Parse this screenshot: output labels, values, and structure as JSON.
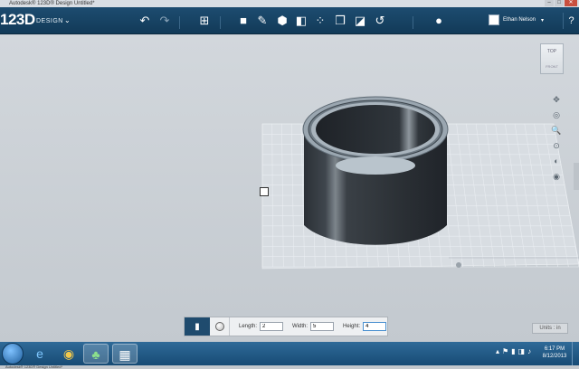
{
  "window": {
    "title": "Autodesk® 123D® Design Untitled*",
    "controls": {
      "minimize": "–",
      "maximize": "□",
      "close": "✕"
    }
  },
  "app": {
    "logo_main": "123D",
    "logo_sub": "DESIGN",
    "menu_caret": "⌄",
    "user_name": "Ethan Nelson",
    "user_caret": "▾",
    "help": "?"
  },
  "toolbar": {
    "undo": "↶",
    "redo": "↷",
    "transform": "⊞",
    "sketch": "✎",
    "construct": "⬢",
    "primitives": "■",
    "modify": "◧",
    "pattern": "⁘",
    "group": "❒",
    "combine": "◪",
    "measure": "↺",
    "material": "●"
  },
  "viewcube": {
    "top_label": "TOP",
    "front_label": "FRONT"
  },
  "navbar": {
    "pan": "✥",
    "orbit": "◎",
    "zoom": "🔍",
    "fit": "⊙",
    "views": "◐",
    "visibility": "◉"
  },
  "properties": {
    "box_icon": "▮",
    "length_label": "Length:",
    "length_value": "2",
    "width_label": "Width:",
    "width_value": "5",
    "height_label": "Height:",
    "height_value": "4"
  },
  "units_button": "Units : in",
  "taskbar": {
    "ie": "e",
    "chrome": "◉",
    "app1": "♣",
    "app2": "▦",
    "tray_icons": [
      "▴",
      "⚑",
      "▮",
      "◨",
      "♪"
    ],
    "time": "6:17 PM",
    "date": "8/12/2013"
  },
  "bottom_label": "Autodesk® 123D® Design Untitled*"
}
